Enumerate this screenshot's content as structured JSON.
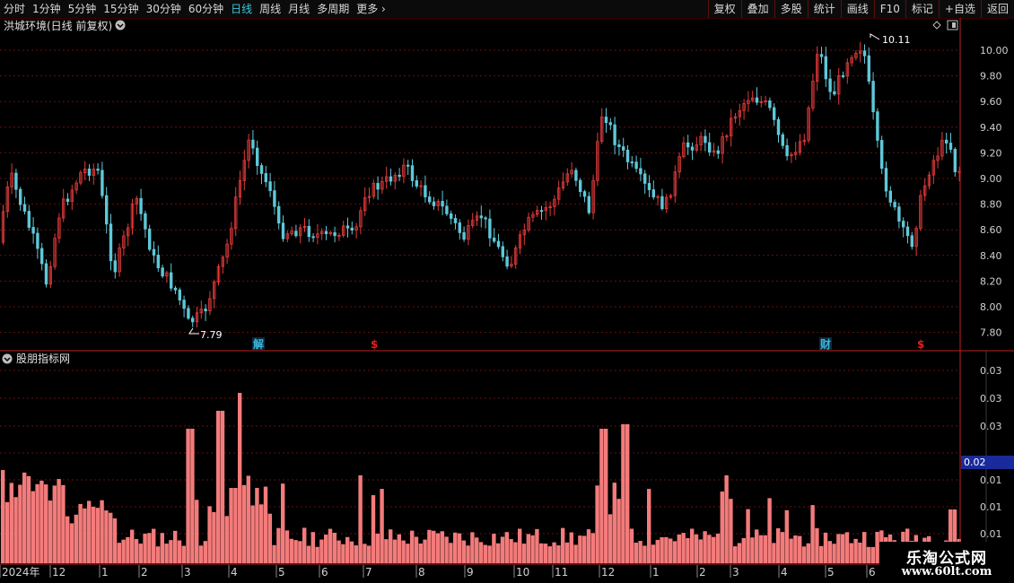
{
  "toolbar": {
    "periods": [
      "分时",
      "1分钟",
      "5分钟",
      "15分钟",
      "30分钟",
      "60分钟",
      "日线",
      "周线",
      "月线",
      "多周期"
    ],
    "active_period": "日线",
    "more_label": "更多",
    "more_icon": "chevron-right-icon",
    "right_buttons": [
      "复权",
      "叠加",
      "多股",
      "统计",
      "画线",
      "F10",
      "标记",
      "+自选",
      "返回"
    ]
  },
  "price_panel": {
    "title": "洪城环境(日线 前复权)",
    "menu_icon": "chevron-down-circle-icon",
    "diamond_icon": "diamond-icon",
    "window_icon": "window-toggle-icon",
    "y_ticks": [
      "10.00",
      "9.80",
      "9.60",
      "9.40",
      "9.20",
      "9.00",
      "8.80",
      "8.60",
      "8.40",
      "8.20",
      "8.00",
      "7.80"
    ],
    "high_label": "10.11",
    "low_label": "7.79",
    "event_markers": [
      {
        "text": "解",
        "color": "#3fb6d8"
      },
      {
        "text": "$",
        "color": "#e02020"
      },
      {
        "text": "财",
        "color": "#3fb6d8"
      },
      {
        "text": "$",
        "color": "#e02020"
      }
    ]
  },
  "indicator_panel": {
    "title": "股朋指标网",
    "menu_icon": "chevron-down-circle-icon",
    "y_ticks": [
      "0.03",
      "0.03",
      "0.03",
      "0.02",
      "0.01",
      "0.01",
      "0.01"
    ],
    "current_value": "0.02"
  },
  "x_axis": {
    "labels": [
      "2024年",
      "12",
      "1",
      "2",
      "3",
      "4",
      "5",
      "6",
      "7",
      "8",
      "9",
      "10",
      "11",
      "12",
      "1",
      "2",
      "3",
      "4",
      "5",
      "6"
    ]
  },
  "colors": {
    "up": "#e33a3a",
    "down": "#5ec8d8",
    "volume": "#f47b7b",
    "grid": "#6a1010",
    "axis": "#c02020",
    "active_tab": "#38c8d8"
  },
  "watermark": {
    "line1": "乐淘公式网",
    "line2": "www.60lt.com"
  }
}
